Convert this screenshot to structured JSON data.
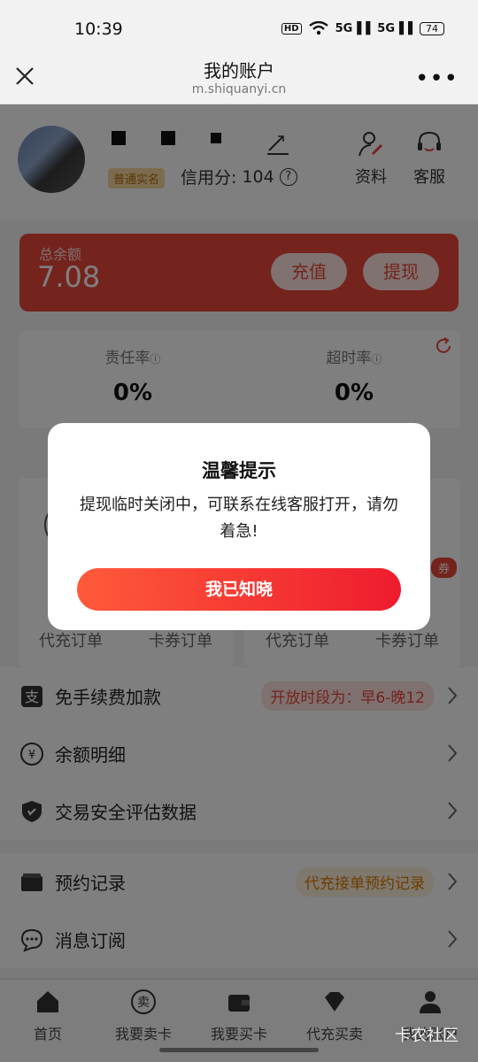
{
  "status_bar": {
    "time": "10:39",
    "hd": "HD",
    "signal1": "5G",
    "signal2": "5G",
    "battery": "74"
  },
  "nav": {
    "title": "我的账户",
    "subtitle": "m.shiquanyi.cn"
  },
  "profile": {
    "badge": "普通实名",
    "credit_label": "信用分:",
    "credit_value": "104",
    "help_mark": "?",
    "profile_label": "资料",
    "service_label": "客服"
  },
  "balance": {
    "label": "总余额",
    "amount": "7.08",
    "recharge": "充值",
    "withdraw": "提现"
  },
  "stats": {
    "responsibility_label": "责任率",
    "responsibility_value": "0%",
    "timeout_label": "超时率",
    "timeout_value": "0%"
  },
  "orders": {
    "left_tab1": "代充订单",
    "left_tab2": "卡券订单",
    "right_tab1": "代充订单",
    "right_tab2": "卡券订单",
    "badge": "券"
  },
  "menu": {
    "fee_free": "免手续费加款",
    "fee_free_tag": "开放时段为：早6-晚12",
    "balance_detail": "余额明细",
    "security": "交易安全评估数据",
    "reservation": "预约记录",
    "reservation_tag": "代充接单预约记录",
    "subscribe": "消息订阅"
  },
  "tabbar": {
    "home": "首页",
    "sell": "我要卖卡",
    "sell_icon_text": "卖",
    "buy": "我要买卡",
    "recharge": "代充买卖",
    "account": "我的账户"
  },
  "dialog": {
    "title": "温馨提示",
    "message": "提现临时关闭中，可联系在线客服打开，请勿着急!",
    "button": "我已知晓"
  },
  "watermark": "卡农社区",
  "colors": {
    "accent": "#e8463a",
    "button_gradient_start": "#ff5a3a",
    "button_gradient_end": "#ee1c2e",
    "tag_bg": "#fde3df",
    "tag_text": "#e8463a",
    "orange_tag_bg": "#fdf0dc",
    "orange_tag_text": "#d97b00"
  }
}
